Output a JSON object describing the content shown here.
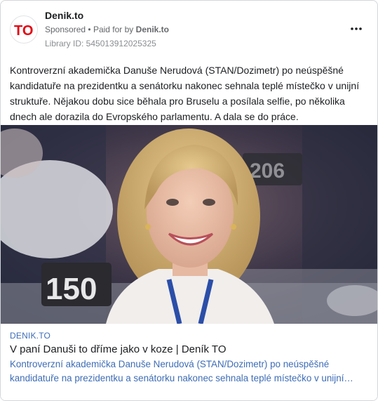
{
  "header": {
    "page_name": "Denik.to",
    "sponsored_label": "Sponsored",
    "separator": "•",
    "paid_for_by_label": "Paid for by",
    "paid_for_by_name": "Denik.to",
    "library_id": "Library ID: 545013912025325",
    "logo_text": "TO",
    "brand_color": "#e30613"
  },
  "post": {
    "body": "Kontroverzní akademička Danuše Nerudová (STAN/Dozimetr) po neúspěšné kandidatuře na prezidentku a senátorku nakonec sehnala teplé místečko v unijní struktuře. Nějakou dobu sice běhala pro Bruselu a posílala selfie, po několika dnech ale dorazila do Evropského parlamentu. A dala se do práce."
  },
  "image": {
    "seat_number_left": "150",
    "seat_number_back": "206"
  },
  "link_preview": {
    "domain": "DENIK.TO",
    "title": "V paní Danuši to dříme jako v koze | Deník TO",
    "description": "Kontroverzní akademička Danuše Nerudová (STAN/Dozimetr) po neúspěšné kandidatuře na prezidentku a senátorku nakonec sehnala teplé místečko v unijní strukturu…"
  },
  "icons": {
    "more": "more-options-icon"
  }
}
